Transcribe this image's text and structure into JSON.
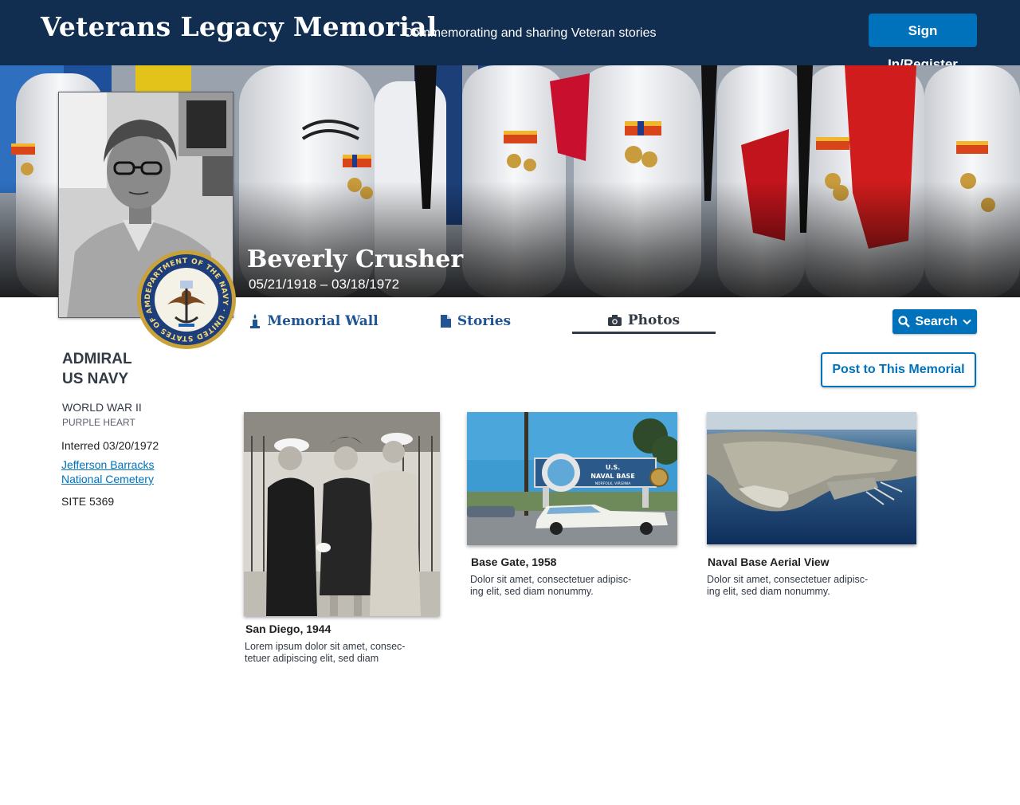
{
  "header": {
    "site_title": "Veterans Legacy Memorial",
    "tagline": "Commemorating and sharing Veteran stories",
    "signin_label": "Sign In/Register"
  },
  "veteran": {
    "name": "Beverly Crusher",
    "dates": "05/21/1918 – 03/18/1972",
    "rank_line1": "ADMIRAL",
    "rank_line2": "US NAVY",
    "war": "WORLD WAR II",
    "award": "PURPLE HEART",
    "interred": "Interred 03/20/1972",
    "cemetery": "Jefferson Barracks National Cemetery",
    "site": "SITE 5369"
  },
  "seal": {
    "text": "DEPARTMENT OF THE NAVY · UNITED STATES OF AMERICA ·"
  },
  "tabs": [
    {
      "label": "Memorial Wall",
      "icon": "candle-icon",
      "active": false
    },
    {
      "label": "Stories",
      "icon": "document-icon",
      "active": false
    },
    {
      "label": "Photos",
      "icon": "camera-icon",
      "active": true
    }
  ],
  "search": {
    "label": "Search",
    "icon": "search-icon"
  },
  "post_button_label": "Post to This Memorial",
  "photos": [
    {
      "title": "San Diego, 1944",
      "caption_1": "Lorem ipsum dolor sit amet, consec-",
      "caption_2": "tetuer adipiscing elit, sed diam"
    },
    {
      "title": "Base Gate, 1958",
      "caption_1": "Dolor sit amet, consectetuer adipisc-",
      "caption_2": "ing elit, sed diam nonummy.",
      "sign_line1": "U.S.",
      "sign_line2": "NAVAL BASE",
      "sign_line3": "NORFOLK, VIRGINIA"
    },
    {
      "title": "Naval Base Aerial View",
      "caption_1": "Dolor sit amet, consectetuer adipisc-",
      "caption_2": "ing elit, sed diam nonummy."
    }
  ],
  "colors": {
    "header_bg": "#112e51",
    "primary_blue": "#0071bb",
    "tab_blue": "#205493",
    "dark_text": "#323a45"
  }
}
